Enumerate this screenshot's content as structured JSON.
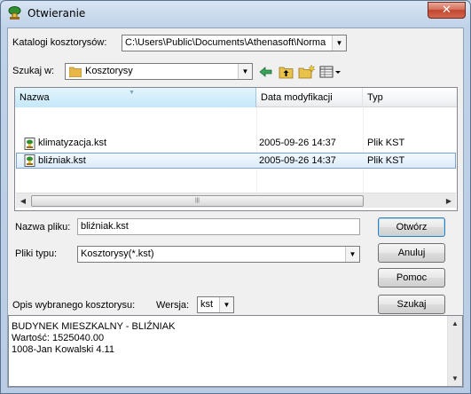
{
  "window": {
    "title": "Otwieranie",
    "close_label": "✕"
  },
  "catalog": {
    "label": "Katalogi kosztorysów:",
    "value": "C:\\Users\\Public\\Documents\\Athenasoft\\Norma"
  },
  "lookin": {
    "label": "Szukaj w:",
    "value": "Kosztorysy"
  },
  "toolbar": {
    "icons": [
      "back-icon",
      "up-folder-icon",
      "new-folder-icon",
      "view-menu-icon"
    ]
  },
  "list": {
    "columns": [
      "Nazwa",
      "Data modyfikacji",
      "Typ"
    ],
    "rows": [
      {
        "name": "klimatyzacja.kst",
        "date": "2005-09-26 14:37",
        "type": "Plik KST"
      },
      {
        "name": "bliźniak.kst",
        "date": "2005-09-26 14:37",
        "type": "Plik KST"
      }
    ],
    "selected_row": "bliźniak.kst"
  },
  "filename": {
    "label": "Nazwa pliku:",
    "value": "bliźniak.kst"
  },
  "filetype": {
    "label": "Pliki typu:",
    "value": "Kosztorysy(*.kst)"
  },
  "buttons": {
    "open": "Otwórz",
    "cancel": "Anuluj",
    "help": "Pomoc",
    "search": "Szukaj"
  },
  "description": {
    "label": "Opis wybranego kosztorysu:",
    "version_label": "Wersja:",
    "version_value": "kst",
    "lines": [
      "BUDYNEK  MIESZKALNY - BLIŹNIAK",
      "Wartość: 1525040.00",
      "1008-Jan Kowalski 4.11"
    ]
  },
  "colors": {
    "selection": "#dcecfc",
    "accent_border": "#3c7fb1",
    "folder": "#e8b74a",
    "title_close": "#c24632"
  }
}
